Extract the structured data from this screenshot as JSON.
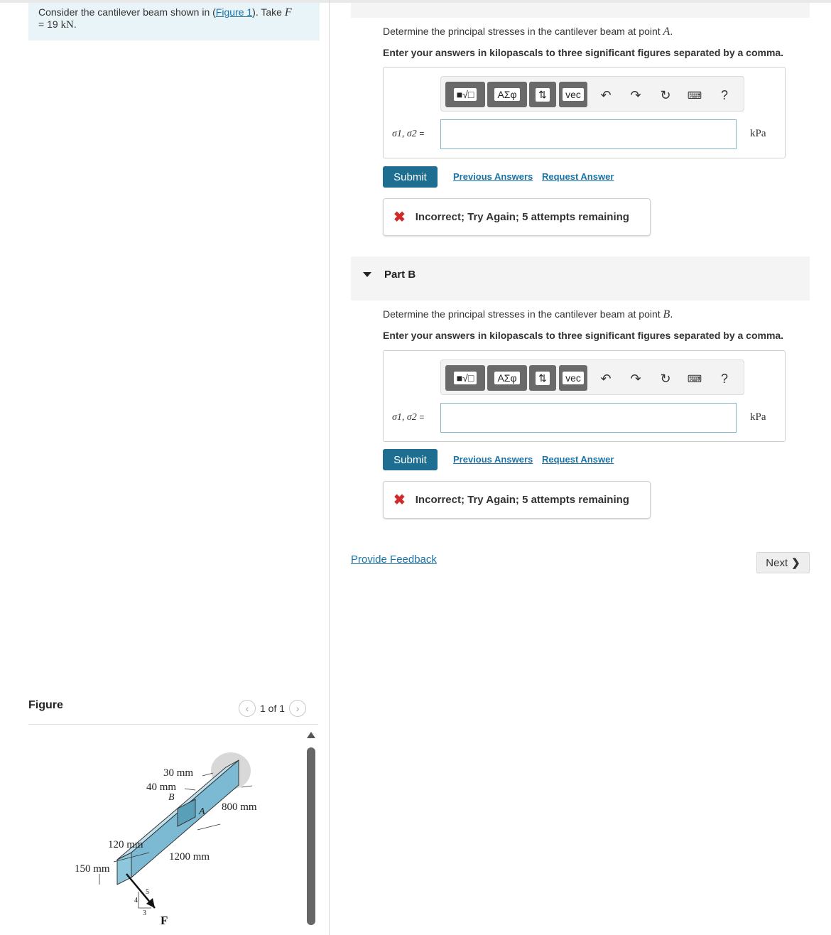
{
  "problem": {
    "text_before_link": "Consider the cantilever beam shown in (",
    "figure_link": "Figure 1",
    "text_after_link": "). Take ",
    "var": "F",
    "value": "= 19",
    "unit": "kN",
    "period": "."
  },
  "figure": {
    "label": "Figure",
    "pager_text": "1 of 1",
    "prev_icon": "chevron-left-icon",
    "next_icon": "chevron-right-icon",
    "labels": {
      "d30": "30 mm",
      "d40": "40 mm",
      "pointB": "B",
      "pointA": "A",
      "d800": "800 mm",
      "d120": "120 mm",
      "d150": "150 mm",
      "d1200": "1200 mm",
      "force": "F",
      "slope_4": "4",
      "slope_5": "5",
      "slope_3": "3"
    }
  },
  "partA": {
    "question_prefix": "Determine the principal stresses in the cantilever beam at point ",
    "point": "A",
    "question_suffix": ".",
    "instruction": "Enter your answers in kilopascals to three significant figures separated by a comma.",
    "var_label": "σ1, σ2",
    "equals": "=",
    "input_value": "",
    "unit": "kPa",
    "submit_label": "Submit",
    "previous_answers_label": "Previous Answers",
    "request_answer_label": "Request Answer",
    "feedback": "Incorrect; Try Again; 5 attempts remaining"
  },
  "partB": {
    "title": "Part B",
    "question_prefix": "Determine the principal stresses in the cantilever beam at point ",
    "point": "B",
    "question_suffix": ".",
    "instruction": "Enter your answers in kilopascals to three significant figures separated by a comma.",
    "var_label": "σ1, σ2",
    "equals": "=",
    "input_value": "",
    "unit": "kPa",
    "submit_label": "Submit",
    "previous_answers_label": "Previous Answers",
    "request_answer_label": "Request Answer",
    "feedback": "Incorrect; Try Again; 5 attempts remaining"
  },
  "toolbar": {
    "greek_label": "ΑΣφ",
    "vec_label": "vec",
    "help_label": "?",
    "icons": [
      "templates-icon",
      "greek-icon",
      "arrows-icon",
      "vec-icon",
      "undo-icon",
      "redo-icon",
      "reset-icon",
      "keyboard-icon",
      "help-icon"
    ]
  },
  "footer": {
    "provide_feedback": "Provide Feedback",
    "next_label": "Next"
  },
  "colors": {
    "submit": "#1d6e91",
    "link": "#1a73a8",
    "error": "#d12a2a",
    "problem_bg": "#e8f4f7",
    "beam": "#8ec7dc"
  }
}
